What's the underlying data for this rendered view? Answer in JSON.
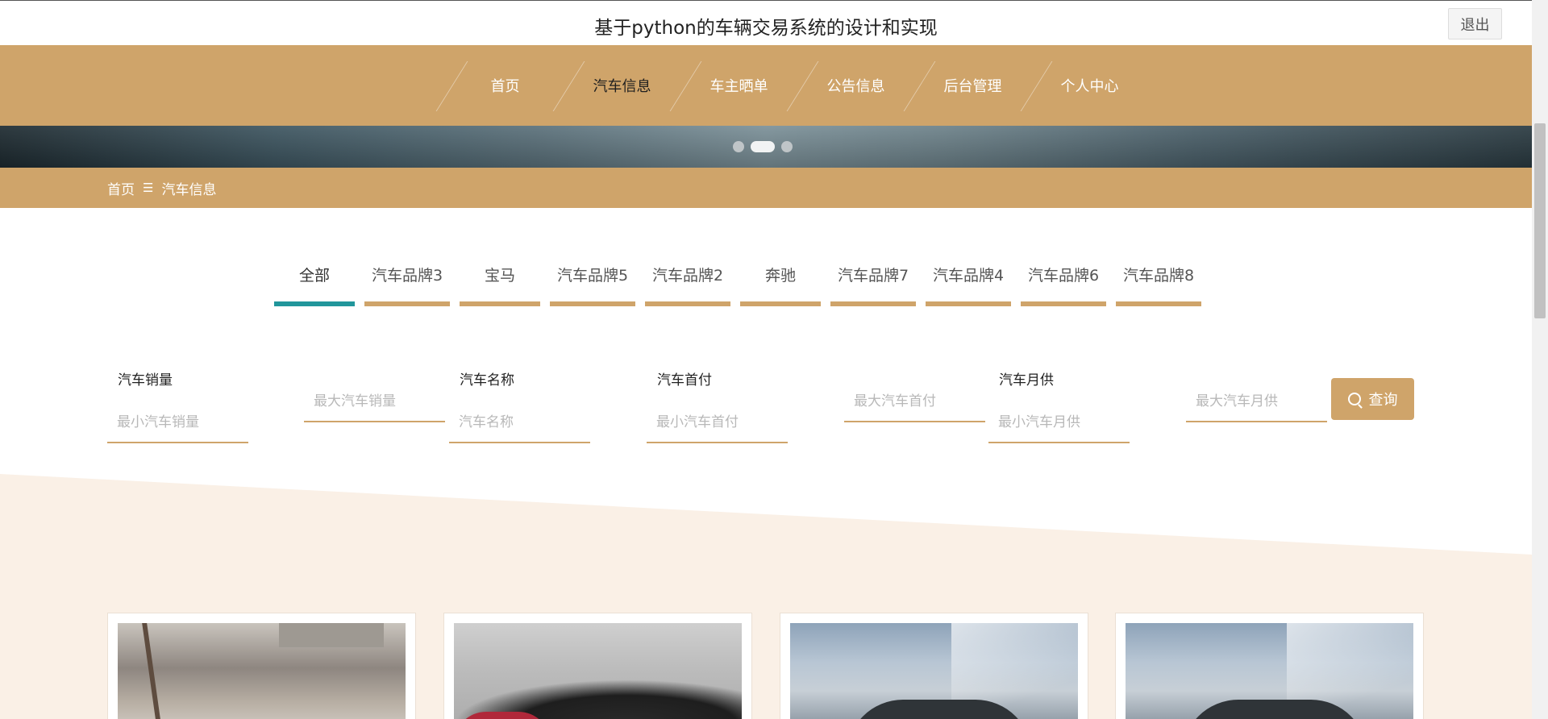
{
  "header": {
    "title": "基于python的车辆交易系统的设计和实现",
    "logout_label": "退出"
  },
  "nav": {
    "items": [
      {
        "label": "首页"
      },
      {
        "label": "汽车信息",
        "active": true
      },
      {
        "label": "车主晒单"
      },
      {
        "label": "公告信息"
      },
      {
        "label": "后台管理"
      },
      {
        "label": "个人中心"
      }
    ]
  },
  "carousel": {
    "slide_count": 3,
    "active_index": 1
  },
  "breadcrumb": {
    "home": "首页",
    "separator": "☰",
    "current": "汽车信息"
  },
  "categories": [
    {
      "label": "全部",
      "active": true
    },
    {
      "label": "汽车品牌3"
    },
    {
      "label": "宝马"
    },
    {
      "label": "汽车品牌5"
    },
    {
      "label": "汽车品牌2"
    },
    {
      "label": "奔驰"
    },
    {
      "label": "汽车品牌7"
    },
    {
      "label": "汽车品牌4"
    },
    {
      "label": "汽车品牌6"
    },
    {
      "label": "汽车品牌8"
    }
  ],
  "filters": {
    "sales_label": "汽车销量",
    "sales_min_placeholder": "最小汽车销量",
    "sales_max_placeholder": "最大汽车销量",
    "name_label": "汽车名称",
    "name_placeholder": "汽车名称",
    "down_payment_label": "汽车首付",
    "down_payment_min_placeholder": "最小汽车首付",
    "down_payment_max_placeholder": "最大汽车首付",
    "monthly_label": "汽车月供",
    "monthly_min_placeholder": "最小汽车月供",
    "monthly_max_placeholder": "最大汽车月供",
    "search_label": "查询"
  },
  "theme": {
    "accent": "#cfa46a",
    "active_tab": "#21969b",
    "cream": "#faf0e6"
  }
}
